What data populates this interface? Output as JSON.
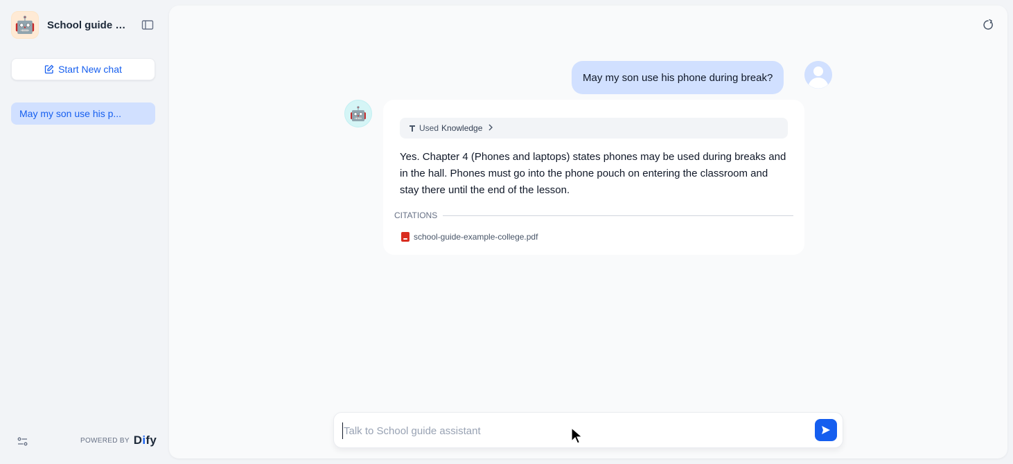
{
  "app": {
    "title": "School guide a...",
    "icon": "robot-emoji"
  },
  "sidebar": {
    "new_chat_label": "Start New chat",
    "conversations": [
      {
        "label": "May my son use his p..."
      }
    ],
    "powered_by_label": "POWERED BY",
    "brand": {
      "part1": "D",
      "part2": "i",
      "part3": "fy"
    }
  },
  "chat": {
    "user_message": "May my son use his phone during break?",
    "bot": {
      "knowledge_chip": {
        "used": "Used",
        "knowledge": "Knowledge"
      },
      "answer": "Yes. Chapter 4 (Phones and laptops) states phones may be used during breaks and in the hall. Phones must go into the phone pouch on entering the classroom and stay there until the end of the lesson.",
      "citations_label": "CITATIONS",
      "citations": [
        {
          "file": "school-guide-example-college.pdf"
        }
      ]
    }
  },
  "input": {
    "placeholder": "Talk to School guide assistant",
    "value": ""
  },
  "colors": {
    "accent": "#155eef",
    "user_bubble": "#d1e0ff",
    "sidebar_active": "#d1e0ff",
    "pdf_red": "#d92d20"
  }
}
